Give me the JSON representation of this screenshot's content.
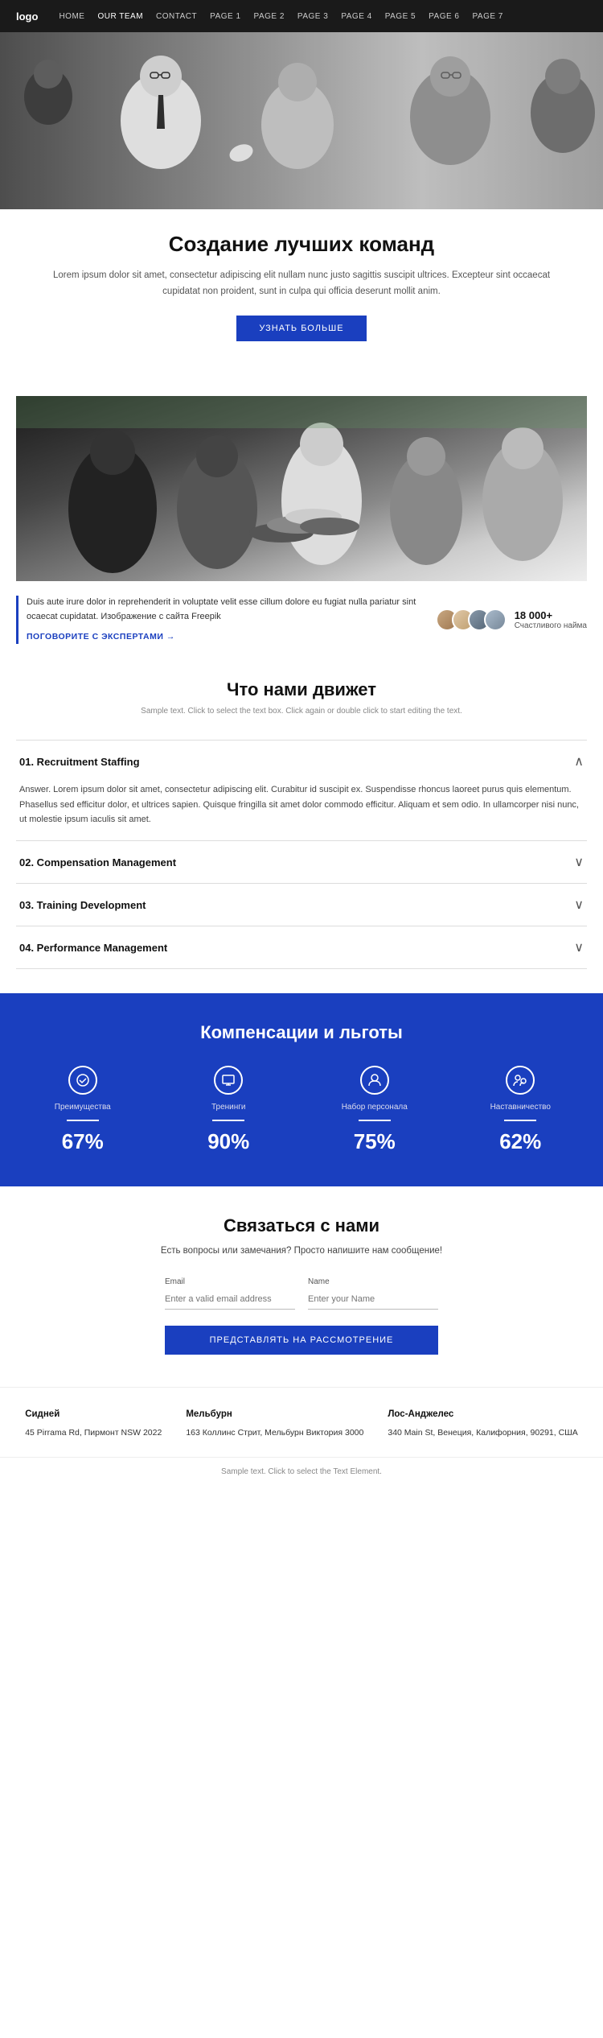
{
  "nav": {
    "logo": "logo",
    "links": [
      {
        "label": "HOME",
        "active": false
      },
      {
        "label": "OUR TEAM",
        "active": true
      },
      {
        "label": "CONTACT",
        "active": false
      },
      {
        "label": "PAGE 1",
        "active": false
      },
      {
        "label": "PAGE 2",
        "active": false
      },
      {
        "label": "PAGE 3",
        "active": false
      },
      {
        "label": "PAGE 4",
        "active": false
      },
      {
        "label": "PAGE 5",
        "active": false
      },
      {
        "label": "PAGE 6",
        "active": false
      },
      {
        "label": "PAGE 7",
        "active": false
      }
    ]
  },
  "hero": {
    "title": "Создание лучших команд",
    "description": "Lorem ipsum dolor sit amet, consectetur adipiscing elit nullam nunc justo sagittis suscipit ultrices. Excepteur sint occaecat cupidatat non proident, sunt in culpa qui officia deserunt mollit anim.",
    "button": "УЗНАТЬ БОЛЬШЕ"
  },
  "team_section": {
    "stats_text": "Duis aute irure dolor in reprehenderit in voluptate velit esse cillum dolore eu fugiat nulla pariatur sint ocaecat cupidatat. Изображение с сайта Freepik",
    "link_text": "ПОГОВОРИТЕ С ЭКСПЕРТАМИ →",
    "count": "18 000+",
    "count_label": "Счастливого найма"
  },
  "what_drives": {
    "title": "Что нами движет",
    "subtitle": "Sample text. Click to select the text box. Click again or double click to start editing the text.",
    "accordion": [
      {
        "id": "01",
        "label": "01. Recruitment Staffing",
        "open": true,
        "body": "Answer. Lorem ipsum dolor sit amet, consectetur adipiscing elit. Curabitur id suscipit ex. Suspendisse rhoncus laoreet purus quis elementum. Phasellus sed efficitur dolor, et ultrices sapien. Quisque fringilla sit amet dolor commodo efficitur. Aliquam et sem odio. In ullamcorper nisi nunc, ut molestie ipsum iaculis sit amet."
      },
      {
        "id": "02",
        "label": "02. Compensation Management",
        "open": false,
        "body": ""
      },
      {
        "id": "03",
        "label": "03. Training Development",
        "open": false,
        "body": ""
      },
      {
        "id": "04",
        "label": "04. Performance Management",
        "open": false,
        "body": ""
      }
    ]
  },
  "benefits": {
    "title": "Компенсации и льготы",
    "items": [
      {
        "icon": "★",
        "label": "Преимущества",
        "value": "67%"
      },
      {
        "icon": "◎",
        "label": "Тренинги",
        "value": "90%"
      },
      {
        "icon": "▣",
        "label": "Набор персонала",
        "value": "75%"
      },
      {
        "icon": "◈",
        "label": "Наставничество",
        "value": "62%"
      }
    ]
  },
  "contact": {
    "title": "Связаться с нами",
    "description": "Есть вопросы или замечания? Просто напишите нам сообщение!",
    "email_label": "Email",
    "email_placeholder": "Enter a valid email address",
    "name_label": "Name",
    "name_placeholder": "Enter your Name",
    "button": "ПРЕДСТАВЛЯТЬ НА РАССМОТРЕНИЕ",
    "offices": [
      {
        "city": "Сидней",
        "address": "45 Pirrama Rd, Пирмонт NSW 2022"
      },
      {
        "city": "Мельбурн",
        "address": "163 Коллинс Стрит, Мельбурн Виктория 3000"
      },
      {
        "city": "Лос-Анджелес",
        "address": "340 Main St, Венеция, Калифорния, 90291, США"
      }
    ]
  },
  "footer": {
    "note": "Sample text. Click to select the Text Element."
  }
}
